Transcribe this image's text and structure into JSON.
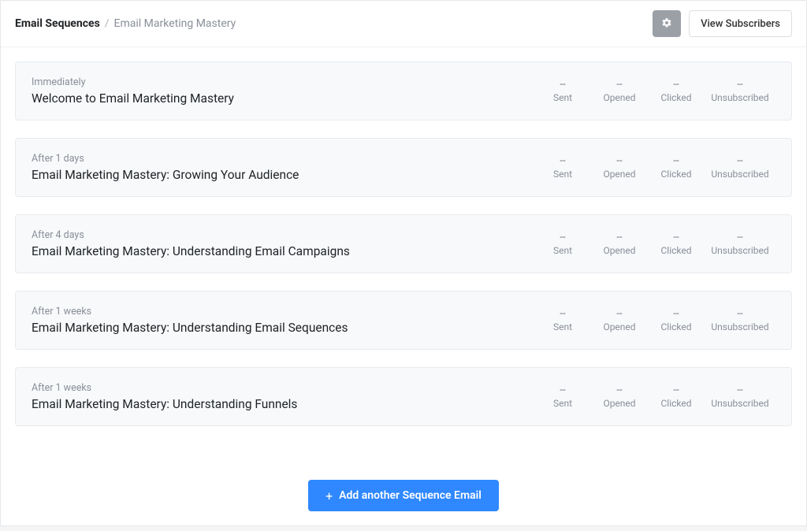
{
  "header": {
    "breadcrumb_root": "Email Sequences",
    "breadcrumb_sep": "/",
    "breadcrumb_current": "Email Marketing Mastery",
    "view_subscribers_label": "View Subscribers"
  },
  "stats_labels": {
    "sent": "Sent",
    "opened": "Opened",
    "clicked": "Clicked",
    "unsubscribed": "Unsubscribed"
  },
  "emails": [
    {
      "timing": "Immediately",
      "title": "Welcome to Email Marketing Mastery",
      "sent": "--",
      "opened": "--",
      "clicked": "--",
      "unsubscribed": "--"
    },
    {
      "timing": "After 1 days",
      "title": "Email Marketing Mastery: Growing Your Audience",
      "sent": "--",
      "opened": "--",
      "clicked": "--",
      "unsubscribed": "--"
    },
    {
      "timing": "After 4 days",
      "title": "Email Marketing Mastery: Understanding Email Campaigns",
      "sent": "--",
      "opened": "--",
      "clicked": "--",
      "unsubscribed": "--"
    },
    {
      "timing": "After 1 weeks",
      "title": "Email Marketing Mastery: Understanding Email Sequences",
      "sent": "--",
      "opened": "--",
      "clicked": "--",
      "unsubscribed": "--"
    },
    {
      "timing": "After 1 weeks",
      "title": "Email Marketing Mastery: Understanding Funnels",
      "sent": "--",
      "opened": "--",
      "clicked": "--",
      "unsubscribed": "--"
    }
  ],
  "footer": {
    "add_email_label": "Add another Sequence Email"
  }
}
